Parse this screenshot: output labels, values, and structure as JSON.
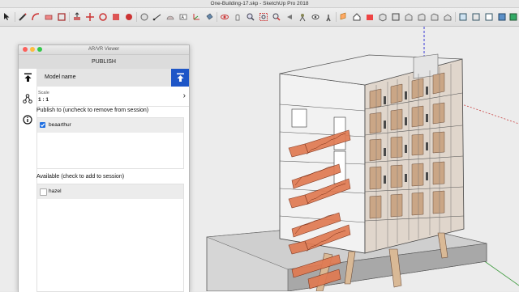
{
  "window": {
    "title": "One-Building-17.skp - SketchUp Pro 2018"
  },
  "toolbar": {
    "icons": [
      "select-icon",
      "pencil-icon",
      "arc-icon",
      "eraser-icon",
      "shape-icon",
      "push-pull-icon",
      "move-icon",
      "rotate-icon",
      "scale-icon",
      "offset-icon",
      "tape-measure-icon",
      "dimension-icon",
      "protractor-icon",
      "text-icon",
      "axes-icon",
      "paint-bucket-icon",
      "orbit-icon",
      "pan-icon",
      "zoom-icon",
      "zoom-window-icon",
      "zoom-extents-icon",
      "previous-view-icon",
      "position-camera-icon",
      "look-around-icon",
      "walk-icon",
      "section-plane-icon",
      "3d-warehouse-icon",
      "extension-warehouse-icon",
      "iso-view-icon",
      "top-view-icon",
      "front-view-icon",
      "right-view-icon",
      "back-view-icon",
      "left-view-icon",
      "xray-icon",
      "wireframe-icon",
      "hidden-line-icon",
      "shaded-icon",
      "shaded-textures-icon",
      "monochrome-icon"
    ]
  },
  "panel": {
    "window_title": "AR/VR Viewer",
    "header": "PUBLISH",
    "model_label": "Model name",
    "scale_label": "Scale",
    "scale_value": "1 : 1",
    "publish_title": "Publish to (uncheck to remove from session)",
    "published_users": [
      {
        "name": "beaarthur",
        "checked": true
      }
    ],
    "available_title": "Available (check to add to session)",
    "available_users": [
      {
        "name": "hazel",
        "checked": false
      }
    ]
  },
  "colors": {
    "accent": "#1e56c7",
    "stair_orange": "#e07a52",
    "facade_panel": "#caa686"
  }
}
